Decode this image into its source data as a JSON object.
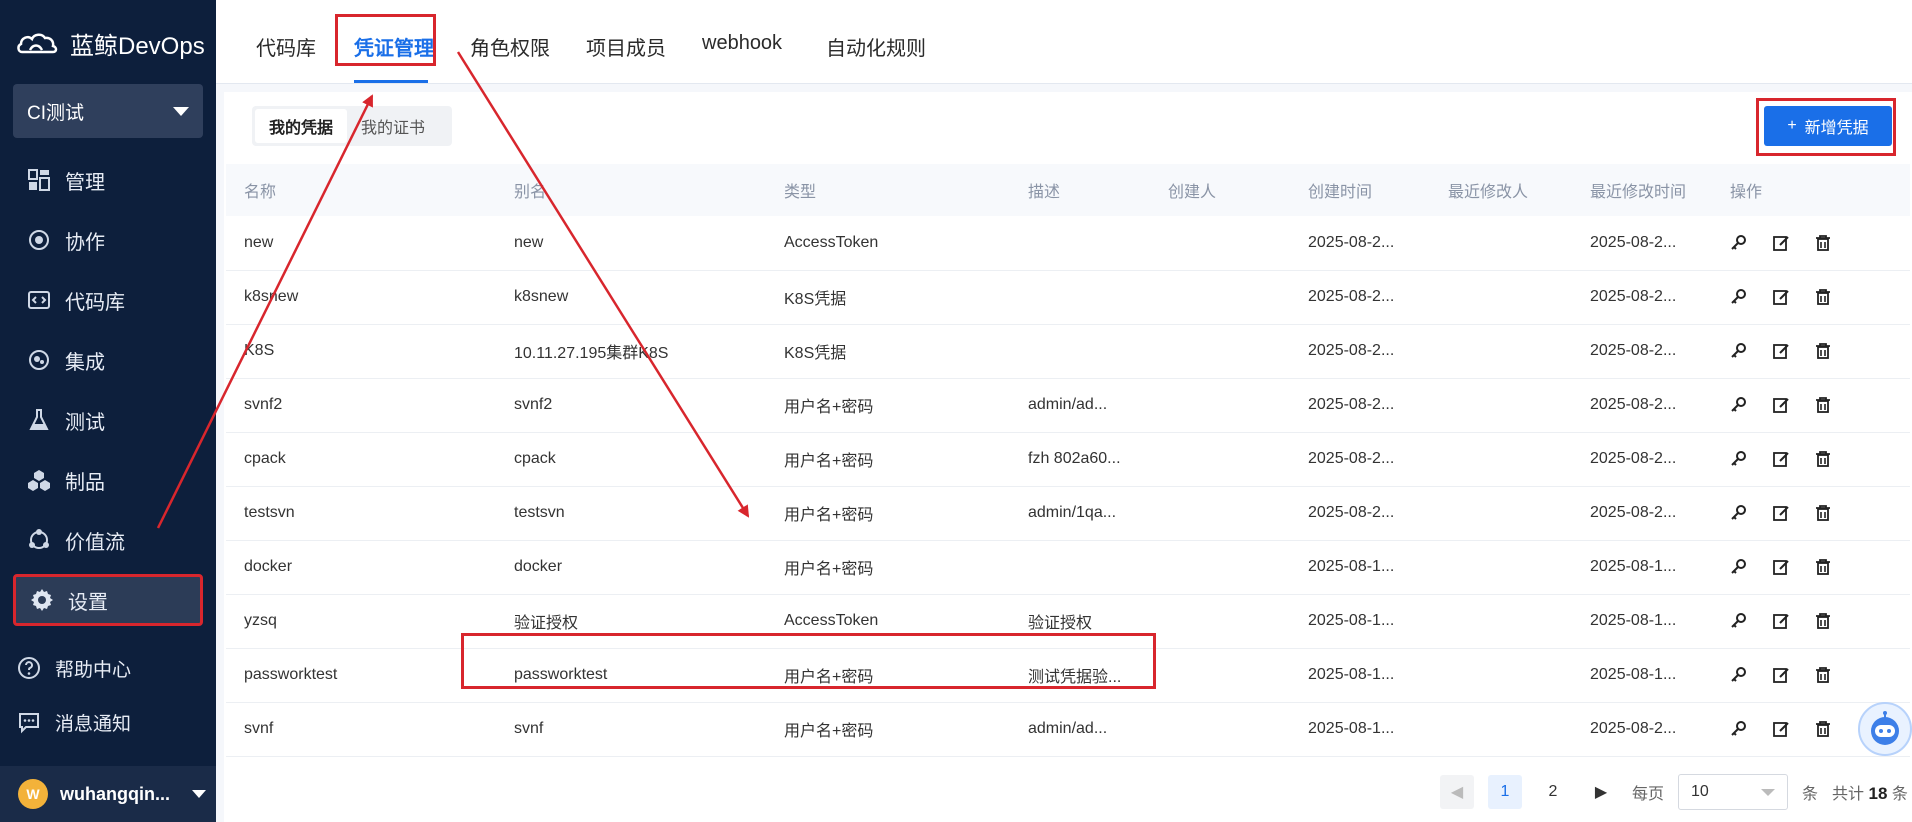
{
  "brand": {
    "name": "蓝鲸DevOps",
    "logo_icon": "bluewhale-logo-icon"
  },
  "project": {
    "name": "CI测试"
  },
  "sidebar": {
    "items": [
      {
        "label": "管理",
        "icon": "dashboard-icon"
      },
      {
        "label": "协作",
        "icon": "collab-icon"
      },
      {
        "label": "代码库",
        "icon": "code-icon"
      },
      {
        "label": "集成",
        "icon": "integration-icon"
      },
      {
        "label": "测试",
        "icon": "flask-icon"
      },
      {
        "label": "制品",
        "icon": "artifact-icon"
      },
      {
        "label": "价值流",
        "icon": "valuestream-icon"
      },
      {
        "label": "设置",
        "icon": "gear-icon"
      }
    ],
    "bottom": [
      {
        "label": "帮助中心",
        "icon": "help-icon"
      },
      {
        "label": "消息通知",
        "icon": "message-icon"
      }
    ]
  },
  "user": {
    "initial": "W",
    "name": "wuhangqin..."
  },
  "tabs": [
    "代码库",
    "凭证管理",
    "角色权限",
    "项目成员",
    "webhook",
    "自动化规则"
  ],
  "subtabs": [
    "我的凭据",
    "我的证书"
  ],
  "add_button": {
    "label": "新增凭据",
    "plus": "+"
  },
  "table": {
    "headers": [
      "名称",
      "别名",
      "类型",
      "描述",
      "创建人",
      "创建时间",
      "最近修改人",
      "最近修改时间",
      "操作"
    ],
    "rows": [
      [
        "new",
        "new",
        "AccessToken",
        "",
        "",
        "2025-08-2...",
        "",
        "2025-08-2..."
      ],
      [
        "k8snew",
        "k8snew",
        "K8S凭据",
        "",
        "",
        "2025-08-2...",
        "",
        "2025-08-2..."
      ],
      [
        "K8S",
        "10.11.27.195集群K8S",
        "K8S凭据",
        "",
        "",
        "2025-08-2...",
        "",
        "2025-08-2..."
      ],
      [
        "svnf2",
        "svnf2",
        "用户名+密码",
        "admin/ad...",
        "",
        "2025-08-2...",
        "",
        "2025-08-2..."
      ],
      [
        "cpack",
        "cpack",
        "用户名+密码",
        "fzh 802a60...",
        "",
        "2025-08-2...",
        "",
        "2025-08-2..."
      ],
      [
        "testsvn",
        "testsvn",
        "用户名+密码",
        "admin/1qa...",
        "",
        "2025-08-2...",
        "",
        "2025-08-2..."
      ],
      [
        "docker",
        "docker",
        "用户名+密码",
        "",
        "",
        "2025-08-1...",
        "",
        "2025-08-1..."
      ],
      [
        "yzsq",
        "验证授权",
        "AccessToken",
        "验证授权",
        "",
        "2025-08-1...",
        "",
        "2025-08-1..."
      ],
      [
        "passworktest",
        "passworktest",
        "用户名+密码",
        "测试凭据验...",
        "",
        "2025-08-1...",
        "",
        "2025-08-1..."
      ],
      [
        "svnf",
        "svnf",
        "用户名+密码",
        "admin/ad...",
        "",
        "2025-08-1...",
        "",
        "2025-08-2..."
      ]
    ],
    "row_actions": [
      "key-icon",
      "edit-icon",
      "delete-icon"
    ]
  },
  "pagination": {
    "pages": [
      "1",
      "2"
    ],
    "current": "1",
    "per_page_label": "每页",
    "per_page": "10",
    "unit": "条",
    "total_prefix": "共计",
    "total": "18",
    "total_suffix": "条"
  },
  "colors": {
    "sidebar_bg": "#0d1f3c",
    "accent": "#1a6fe8",
    "annotation": "#d8262d"
  }
}
